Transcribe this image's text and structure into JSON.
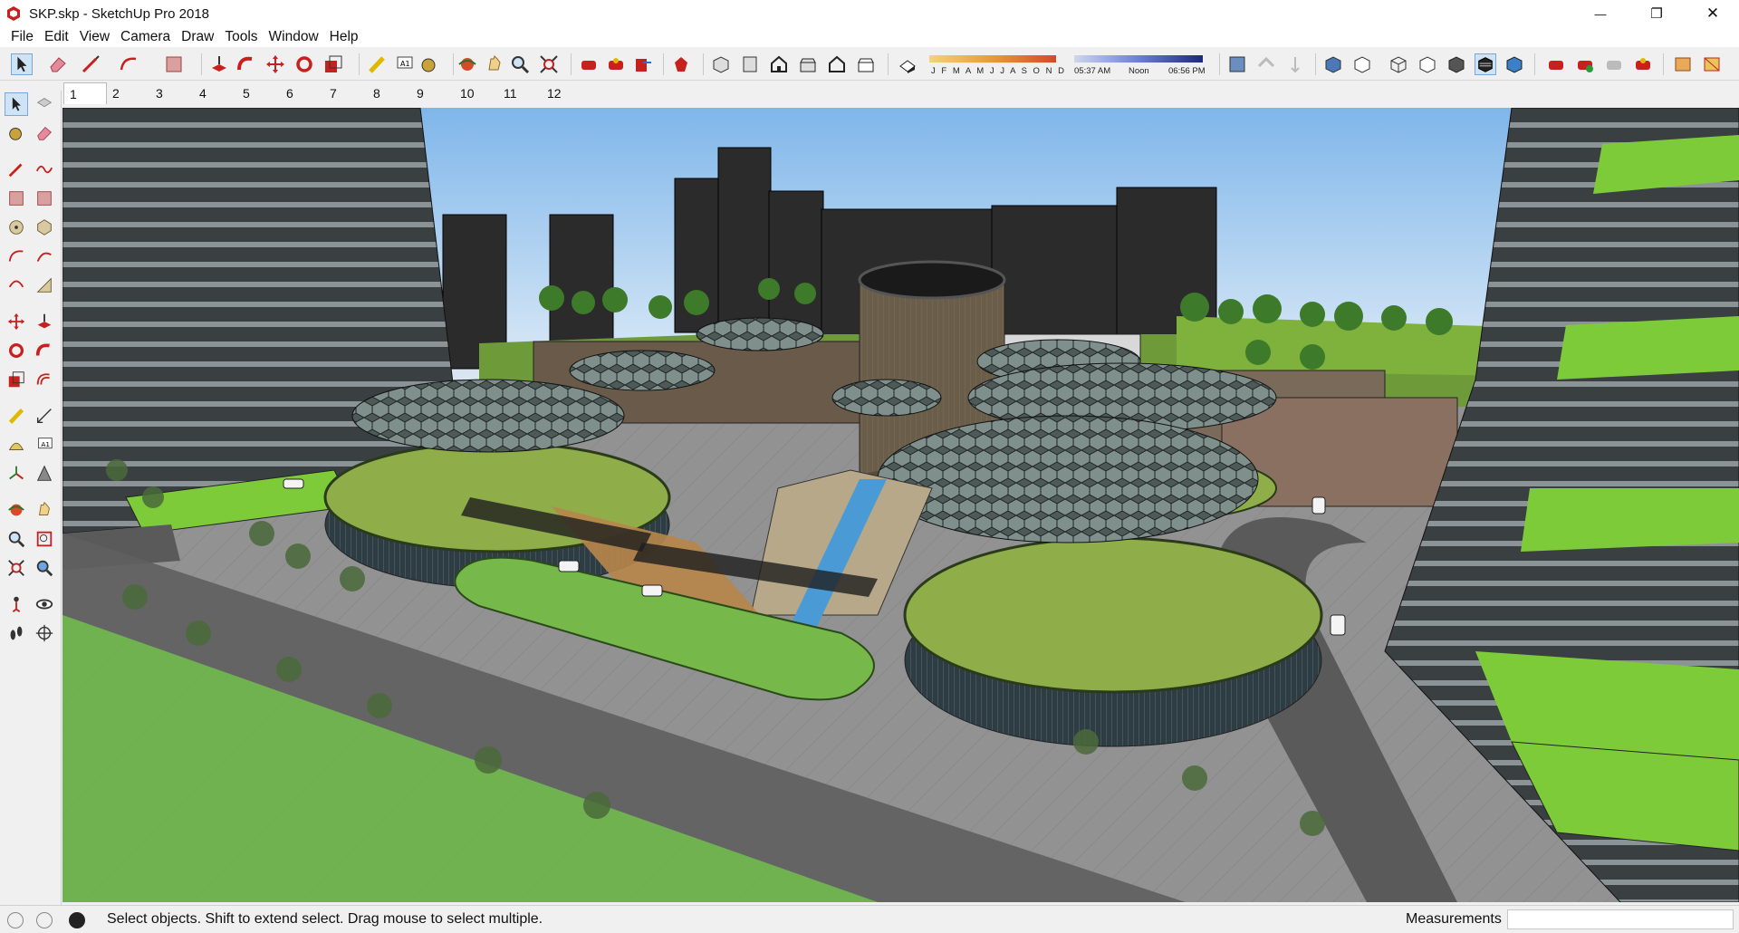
{
  "window": {
    "title": "SKP.skp - SketchUp Pro 2018",
    "minimize_glyph": "—",
    "restore_glyph": "❐",
    "close_glyph": "✕"
  },
  "menu": [
    "File",
    "Edit",
    "View",
    "Camera",
    "Draw",
    "Tools",
    "Window",
    "Help"
  ],
  "shadows": {
    "months": "J F M A M J J A S O N D",
    "time_start": "05:37 AM",
    "time_mid": "Noon",
    "time_end": "06:56 PM"
  },
  "scene_tabs": [
    "1",
    "2",
    "3",
    "4",
    "5",
    "6",
    "7",
    "8",
    "9",
    "10",
    "11",
    "12"
  ],
  "active_scene": "1",
  "status": {
    "message": "Select objects. Shift to extend select. Drag mouse to select multiple.",
    "measurements_label": "Measurements",
    "measurements_value": ""
  },
  "colors": {
    "accent_red": "#c8201e",
    "sky": "#9cc7ee",
    "grass": "#7fb13d",
    "building_dark": "#2c2c2c"
  }
}
